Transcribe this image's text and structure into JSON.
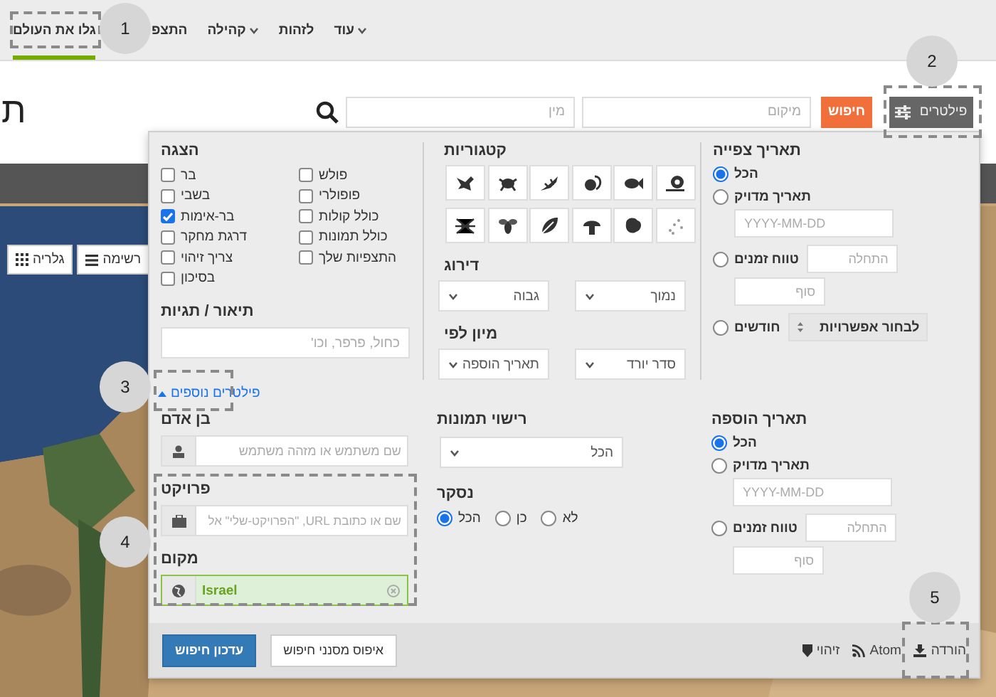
{
  "nav": {
    "items": [
      {
        "label": "עוד",
        "selected": false,
        "caret": true
      },
      {
        "label": "לזהות",
        "selected": false,
        "caret": false
      },
      {
        "label": "קהילה",
        "selected": false,
        "caret": true
      },
      {
        "label": "התצפ",
        "selected": false,
        "caret": false
      },
      {
        "label": "גלו את העולם",
        "selected": true,
        "caret": false
      }
    ]
  },
  "page_title": "ת",
  "search_bar": {
    "taxon_placeholder": "מין",
    "place_placeholder": "מיקום",
    "search_button": "חיפוש",
    "filters_button": "פילטרים"
  },
  "view_buttons": [
    {
      "kind": "list",
      "label": "רשימה"
    },
    {
      "kind": "grid",
      "label": "גלריה"
    }
  ],
  "filters": {
    "show": {
      "title": "הצגה",
      "options": [
        {
          "label": "פולש",
          "checked": false
        },
        {
          "label": "פופולרי",
          "checked": false
        },
        {
          "label": "כולל קולות",
          "checked": false
        },
        {
          "label": "כולל תמונות",
          "checked": false
        },
        {
          "label": "התצפיות שלך",
          "checked": false
        },
        {
          "label": "בר",
          "checked": false
        },
        {
          "label": "בשבי",
          "checked": false
        },
        {
          "label": "בר-אימות",
          "checked": true
        },
        {
          "label": "דרגת מחקר",
          "checked": false
        },
        {
          "label": "צריך זיהוי",
          "checked": false
        },
        {
          "label": "בסיכון",
          "checked": false
        }
      ]
    },
    "description": {
      "title": "תיאור / תגיות",
      "placeholder": "כחול, פרפר, וכו'"
    },
    "categories": {
      "title": "קטגוריות"
    },
    "rank": {
      "title": "דירוג",
      "selects": [
        "נמוך",
        "גבוה"
      ]
    },
    "sort": {
      "title": "מיון לפי",
      "selects": [
        "סדר יורד",
        "תאריך הוספה"
      ]
    },
    "observation_date": {
      "title": "תאריך צפייה",
      "options": [
        {
          "kind": "any",
          "label": "הכל",
          "selected": true
        },
        {
          "kind": "exact",
          "label": "תאריך מדויק",
          "selected": false,
          "placeholder": "YYYY-MM-DD"
        },
        {
          "kind": "range",
          "label": "טווח זמנים",
          "selected": false,
          "start_placeholder": "התחלה",
          "end_placeholder": "סוף"
        },
        {
          "kind": "months",
          "label": "חודשים",
          "selected": false,
          "select": "לבחור אפשרויות"
        }
      ]
    },
    "more_filters": "פילטרים נוספים",
    "person": {
      "title": "בן אדם",
      "placeholder": "שם משתמש או מזהה משתמש"
    },
    "project": {
      "title": "פרויקט",
      "placeholder": "שם או כתובת URL, \"הפרויקט-שלי\" אל"
    },
    "place": {
      "title": "מקום",
      "value": "Israel"
    },
    "photo_license": {
      "title": "רישוי תמונות",
      "select": "הכל"
    },
    "reviewed": {
      "title": "נסקר",
      "options": [
        {
          "label": "לא",
          "selected": false
        },
        {
          "label": "כן",
          "selected": false
        },
        {
          "label": "הכל",
          "selected": true
        }
      ]
    },
    "added_date": {
      "title": "תאריך הוספה",
      "options": [
        {
          "kind": "any",
          "label": "הכל",
          "selected": true
        },
        {
          "kind": "exact",
          "label": "תאריך מדויק",
          "selected": false,
          "placeholder": "YYYY-MM-DD"
        },
        {
          "kind": "range",
          "label": "טווח זמנים",
          "selected": false,
          "start_placeholder": "התחלה",
          "end_placeholder": "סוף"
        }
      ]
    },
    "footer": {
      "update_button": "עדכון חיפוש",
      "reset_button": "איפוס מסנני חיפוש",
      "links": [
        {
          "kind": "download",
          "label": "הורדה"
        },
        {
          "kind": "atom",
          "label": "Atom"
        },
        {
          "kind": "identify",
          "label": "זיהוי"
        }
      ]
    }
  },
  "callouts": [
    "1",
    "2",
    "3",
    "4",
    "5"
  ]
}
